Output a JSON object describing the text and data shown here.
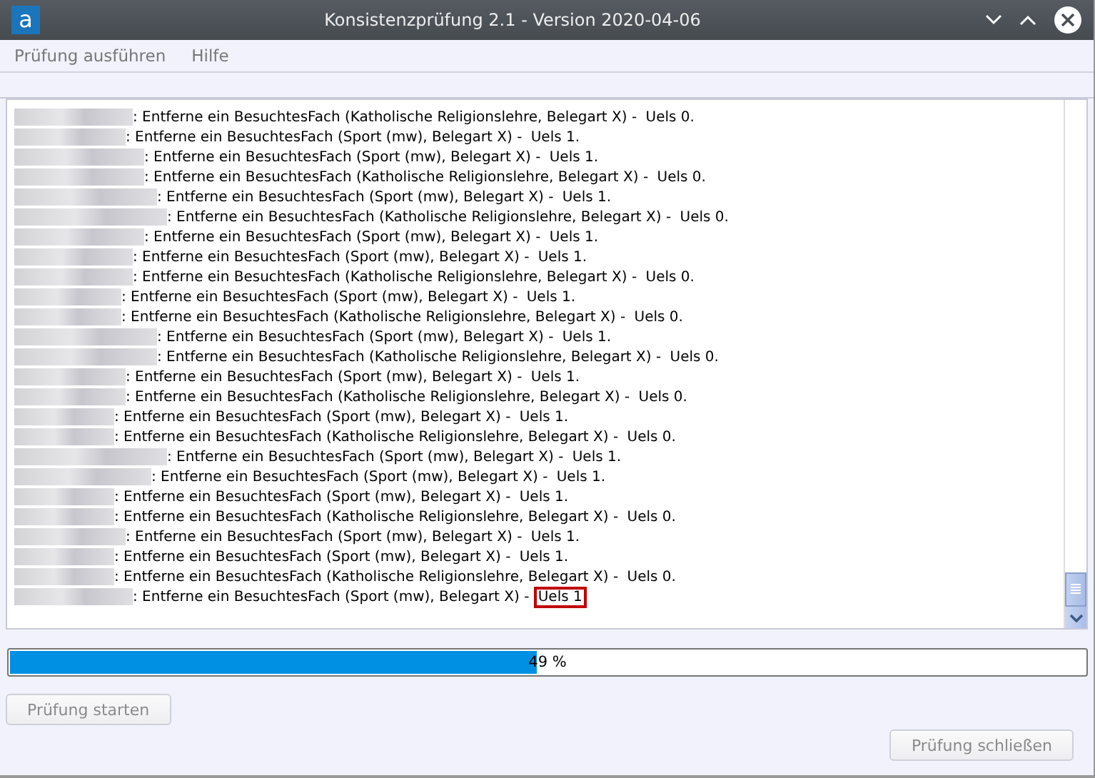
{
  "window": {
    "logo": "a",
    "title": "Konsistenzprüfung 2.1 - Version 2020-04-06"
  },
  "menu": [
    {
      "label": "Prüfung ausführen"
    },
    {
      "label": "Hilfe"
    }
  ],
  "log": [
    {
      "message": ": Entferne ein BesuchtesFach (Katholische Religionslehre, Belegart X) - ",
      "result": "Uels 0.",
      "highlighted": false
    },
    {
      "message": ": Entferne ein BesuchtesFach (Sport (mw), Belegart X) - ",
      "result": "Uels 1.",
      "highlighted": false
    },
    {
      "message": ": Entferne ein BesuchtesFach (Sport (mw), Belegart X) - ",
      "result": "Uels 1.",
      "highlighted": false
    },
    {
      "message": ": Entferne ein BesuchtesFach (Katholische Religionslehre, Belegart X) - ",
      "result": "Uels 0.",
      "highlighted": false
    },
    {
      "message": ": Entferne ein BesuchtesFach (Sport (mw), Belegart X) - ",
      "result": "Uels 1.",
      "highlighted": false
    },
    {
      "message": ": Entferne ein BesuchtesFach (Katholische Religionslehre, Belegart X) - ",
      "result": "Uels 0.",
      "highlighted": false
    },
    {
      "message": ": Entferne ein BesuchtesFach (Sport (mw), Belegart X) - ",
      "result": "Uels 1.",
      "highlighted": false
    },
    {
      "message": ": Entferne ein BesuchtesFach (Sport (mw), Belegart X) - ",
      "result": "Uels 1.",
      "highlighted": false
    },
    {
      "message": ": Entferne ein BesuchtesFach (Katholische Religionslehre, Belegart X) - ",
      "result": "Uels 0.",
      "highlighted": false
    },
    {
      "message": ": Entferne ein BesuchtesFach (Sport (mw), Belegart X) - ",
      "result": "Uels 1.",
      "highlighted": false
    },
    {
      "message": ": Entferne ein BesuchtesFach (Katholische Religionslehre, Belegart X) - ",
      "result": "Uels 0.",
      "highlighted": false
    },
    {
      "message": ": Entferne ein BesuchtesFach (Sport (mw), Belegart X) - ",
      "result": "Uels 1.",
      "highlighted": false
    },
    {
      "message": ": Entferne ein BesuchtesFach (Katholische Religionslehre, Belegart X) - ",
      "result": "Uels 0.",
      "highlighted": false
    },
    {
      "message": ": Entferne ein BesuchtesFach (Sport (mw), Belegart X) - ",
      "result": "Uels 1.",
      "highlighted": false
    },
    {
      "message": ": Entferne ein BesuchtesFach (Katholische Religionslehre, Belegart X) - ",
      "result": "Uels 0.",
      "highlighted": false
    },
    {
      "message": ": Entferne ein BesuchtesFach (Sport (mw), Belegart X) - ",
      "result": "Uels 1.",
      "highlighted": false
    },
    {
      "message": ": Entferne ein BesuchtesFach (Katholische Religionslehre, Belegart X) - ",
      "result": "Uels 0.",
      "highlighted": false
    },
    {
      "message": ": Entferne ein BesuchtesFach (Sport (mw), Belegart X) - ",
      "result": "Uels 1.",
      "highlighted": false
    },
    {
      "message": ": Entferne ein BesuchtesFach (Sport (mw), Belegart X) - ",
      "result": "Uels 1.",
      "highlighted": false
    },
    {
      "message": ": Entferne ein BesuchtesFach (Sport (mw), Belegart X) - ",
      "result": "Uels 1.",
      "highlighted": false
    },
    {
      "message": ": Entferne ein BesuchtesFach (Katholische Religionslehre, Belegart X) - ",
      "result": "Uels 0.",
      "highlighted": false
    },
    {
      "message": ": Entferne ein BesuchtesFach (Sport (mw), Belegart X) - ",
      "result": "Uels 1.",
      "highlighted": false
    },
    {
      "message": ": Entferne ein BesuchtesFach (Sport (mw), Belegart X) - ",
      "result": "Uels 1.",
      "highlighted": false
    },
    {
      "message": ": Entferne ein BesuchtesFach (Katholische Religionslehre, Belegart X) - ",
      "result": "Uels 0.",
      "highlighted": false
    },
    {
      "message": ": Entferne ein BesuchtesFach (Sport (mw), Belegart X) - ",
      "result": "Uels 1",
      "highlighted": true
    }
  ],
  "progress": {
    "level": 0.49,
    "label": "49 %"
  },
  "buttons": [
    {
      "label": "Prüfung starten",
      "disabled": true
    },
    {
      "label": "Prüfung schließen",
      "disabled": true
    }
  ]
}
